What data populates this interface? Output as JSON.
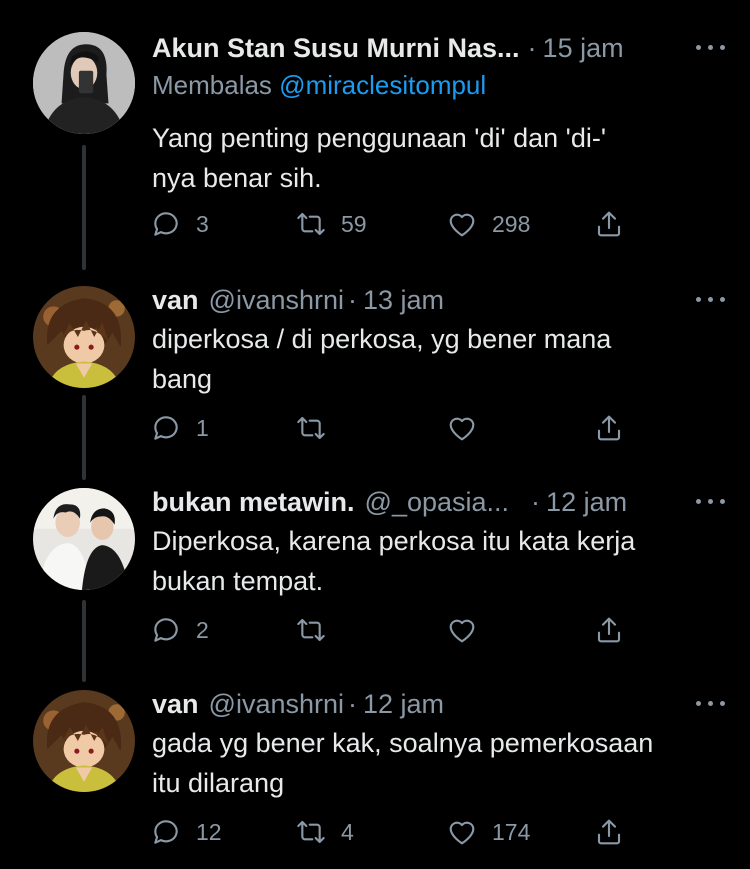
{
  "tweets": [
    {
      "name": "Akun Stan Susu Murni Nas...",
      "handle": "",
      "dot": "·",
      "time": "15 jam",
      "reply_prefix": "Membalas",
      "reply_mention": "@miraclesitompul",
      "text_lines": [
        "Yang penting penggunaan 'di' dan 'di-'",
        "nya benar sih."
      ],
      "replies": "3",
      "retweets": "59",
      "likes": "298",
      "avatar_icon": "user-photo"
    },
    {
      "name": "van",
      "handle": "@ivanshrni",
      "dot": "·",
      "time": "13 jam",
      "text_lines": [
        "diperkosa / di perkosa, yg bener mana",
        "bang"
      ],
      "replies": "1",
      "retweets": "",
      "likes": "",
      "avatar_icon": "anime-avatar"
    },
    {
      "name": "bukan metawin.",
      "handle": "@_opasia...",
      "dot": "·",
      "time": "12 jam",
      "text_lines": [
        "Diperkosa, karena perkosa itu kata kerja",
        "bukan tempat."
      ],
      "replies": "2",
      "retweets": "",
      "likes": "",
      "avatar_icon": "two-people-photo"
    },
    {
      "name": "van",
      "handle": "@ivanshrni",
      "dot": "·",
      "time": "12 jam",
      "text_lines": [
        "gada yg bener kak, soalnya pemerkosaan",
        "itu dilarang"
      ],
      "replies": "12",
      "retweets": "4",
      "likes": "174",
      "avatar_icon": "anime-avatar"
    }
  ],
  "colors": {
    "background": "#000000",
    "text": "#e7e9ea",
    "secondary": "#8b98a5",
    "mention": "#1d9bf0",
    "thread_line": "#2f3336"
  }
}
